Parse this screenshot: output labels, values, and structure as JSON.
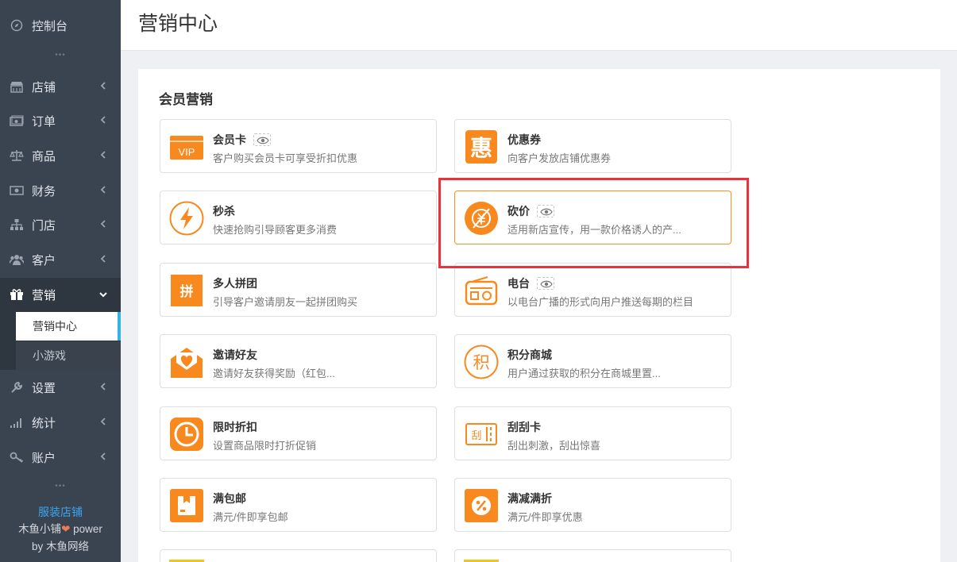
{
  "sidebar": {
    "items": [
      {
        "label": "控制台",
        "icon": "dashboard-icon"
      },
      {
        "label": "店铺",
        "icon": "store-icon"
      },
      {
        "label": "订单",
        "icon": "order-icon"
      },
      {
        "label": "商品",
        "icon": "scale-icon"
      },
      {
        "label": "财务",
        "icon": "money-icon"
      },
      {
        "label": "门店",
        "icon": "sitemap-icon"
      },
      {
        "label": "客户",
        "icon": "users-icon"
      },
      {
        "label": "营销",
        "icon": "gift-icon"
      },
      {
        "label": "设置",
        "icon": "wrench-icon"
      },
      {
        "label": "统计",
        "icon": "signal-icon"
      },
      {
        "label": "账户",
        "icon": "key-icon"
      }
    ],
    "submenu": [
      {
        "label": "营销中心"
      },
      {
        "label": "小游戏"
      }
    ],
    "dots": "•••",
    "footer": {
      "store_name": "服装店铺",
      "power_prefix": "木鱼小铺",
      "power_suffix": "power",
      "by_line": "by 木鱼网络"
    }
  },
  "header": {
    "title": "营销中心"
  },
  "main": {
    "section_title": "会员营销",
    "cards": [
      {
        "name": "会员卡",
        "desc": "客户购买会员卡可享受折扣优惠",
        "icon": "vip-card-icon",
        "eye": true
      },
      {
        "name": "优惠券",
        "desc": "向客户发放店铺优惠券",
        "icon": "coupon-hui-icon",
        "eye": false
      },
      {
        "name": "秒杀",
        "desc": "快速抢购引导顾客更多消费",
        "icon": "lightning-icon",
        "eye": false
      },
      {
        "name": "砍价",
        "desc": "适用新店宣传，用一款价格诱人的产...",
        "icon": "bargain-icon",
        "eye": true
      },
      {
        "name": "多人拼团",
        "desc": "引导客户邀请朋友一起拼团购买",
        "icon": "group-buy-icon",
        "eye": false
      },
      {
        "name": "电台",
        "desc": "以电台广播的形式向用户推送每期的栏目",
        "icon": "radio-icon",
        "eye": true
      },
      {
        "name": "邀请好友",
        "desc": "邀请好友获得奖励（红包...",
        "icon": "invite-heart-icon",
        "eye": false
      },
      {
        "name": "积分商城",
        "desc": "用户通过获取的积分在商城里置...",
        "icon": "points-mall-icon",
        "eye": false
      },
      {
        "name": "限时折扣",
        "desc": "设置商品限时打折促销",
        "icon": "clock-icon",
        "eye": false
      },
      {
        "name": "刮刮卡",
        "desc": "刮出刺激，刮出惊喜",
        "icon": "scratch-card-icon",
        "eye": false
      },
      {
        "name": "满包邮",
        "desc": "满元/件即享包邮",
        "icon": "package-icon",
        "eye": false
      },
      {
        "name": "满减满折",
        "desc": "满元/件即享优惠",
        "icon": "percent-icon",
        "eye": false
      }
    ],
    "icon_text": {
      "vip": "VIP",
      "hui": "惠",
      "pin": "拼",
      "ji": "积",
      "gua": "刮"
    }
  },
  "colors": {
    "accent": "#f7891f",
    "sidebar_bg": "#3a4350",
    "highlight_border": "#e8323c",
    "active_bar": "#34b4e3"
  }
}
